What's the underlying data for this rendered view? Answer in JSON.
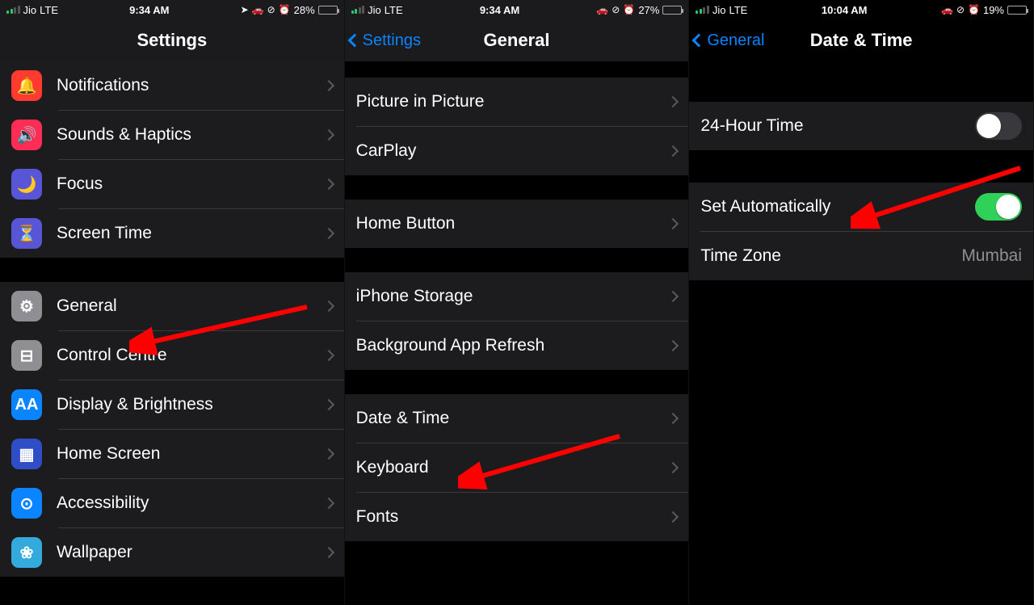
{
  "panel1": {
    "status": {
      "carrier": "Jio",
      "net": "LTE",
      "time": "9:34 AM",
      "battery_pct": "28%",
      "battery_fill": 28
    },
    "title": "Settings",
    "groupA": [
      {
        "id": "notifications",
        "label": "Notifications",
        "icon": "ic-notif",
        "glyph": "🔔"
      },
      {
        "id": "sounds",
        "label": "Sounds & Haptics",
        "icon": "ic-sound",
        "glyph": "🔊"
      },
      {
        "id": "focus",
        "label": "Focus",
        "icon": "ic-focus",
        "glyph": "🌙"
      },
      {
        "id": "screentime",
        "label": "Screen Time",
        "icon": "ic-screentime",
        "glyph": "⏳"
      }
    ],
    "groupB": [
      {
        "id": "general",
        "label": "General",
        "icon": "ic-general",
        "glyph": "⚙"
      },
      {
        "id": "control",
        "label": "Control Centre",
        "icon": "ic-control",
        "glyph": "⊟"
      },
      {
        "id": "display",
        "label": "Display & Brightness",
        "icon": "ic-display",
        "glyph": "AA"
      },
      {
        "id": "home",
        "label": "Home Screen",
        "icon": "ic-home",
        "glyph": "▦"
      },
      {
        "id": "access",
        "label": "Accessibility",
        "icon": "ic-access",
        "glyph": "⊙"
      },
      {
        "id": "wall",
        "label": "Wallpaper",
        "icon": "ic-wall",
        "glyph": "❀"
      }
    ]
  },
  "panel2": {
    "status": {
      "carrier": "Jio",
      "net": "LTE",
      "time": "9:34 AM",
      "battery_pct": "27%",
      "battery_fill": 27
    },
    "back": "Settings",
    "title": "General",
    "groupA": [
      {
        "id": "pip",
        "label": "Picture in Picture"
      },
      {
        "id": "carplay",
        "label": "CarPlay"
      }
    ],
    "groupB": [
      {
        "id": "homebutton",
        "label": "Home Button"
      }
    ],
    "groupC": [
      {
        "id": "storage",
        "label": "iPhone Storage"
      },
      {
        "id": "bgrefresh",
        "label": "Background App Refresh"
      }
    ],
    "groupD": [
      {
        "id": "datetime",
        "label": "Date & Time"
      },
      {
        "id": "keyboard",
        "label": "Keyboard"
      },
      {
        "id": "fonts",
        "label": "Fonts"
      }
    ]
  },
  "panel3": {
    "status": {
      "carrier": "Jio",
      "net": "LTE",
      "time": "10:04 AM",
      "battery_pct": "19%",
      "battery_fill": 19,
      "low": true
    },
    "back": "General",
    "title": "Date & Time",
    "rows": {
      "24h": {
        "label": "24-Hour Time",
        "on": false
      },
      "auto": {
        "label": "Set Automatically",
        "on": true
      },
      "zone": {
        "label": "Time Zone",
        "value": "Mumbai"
      }
    }
  }
}
